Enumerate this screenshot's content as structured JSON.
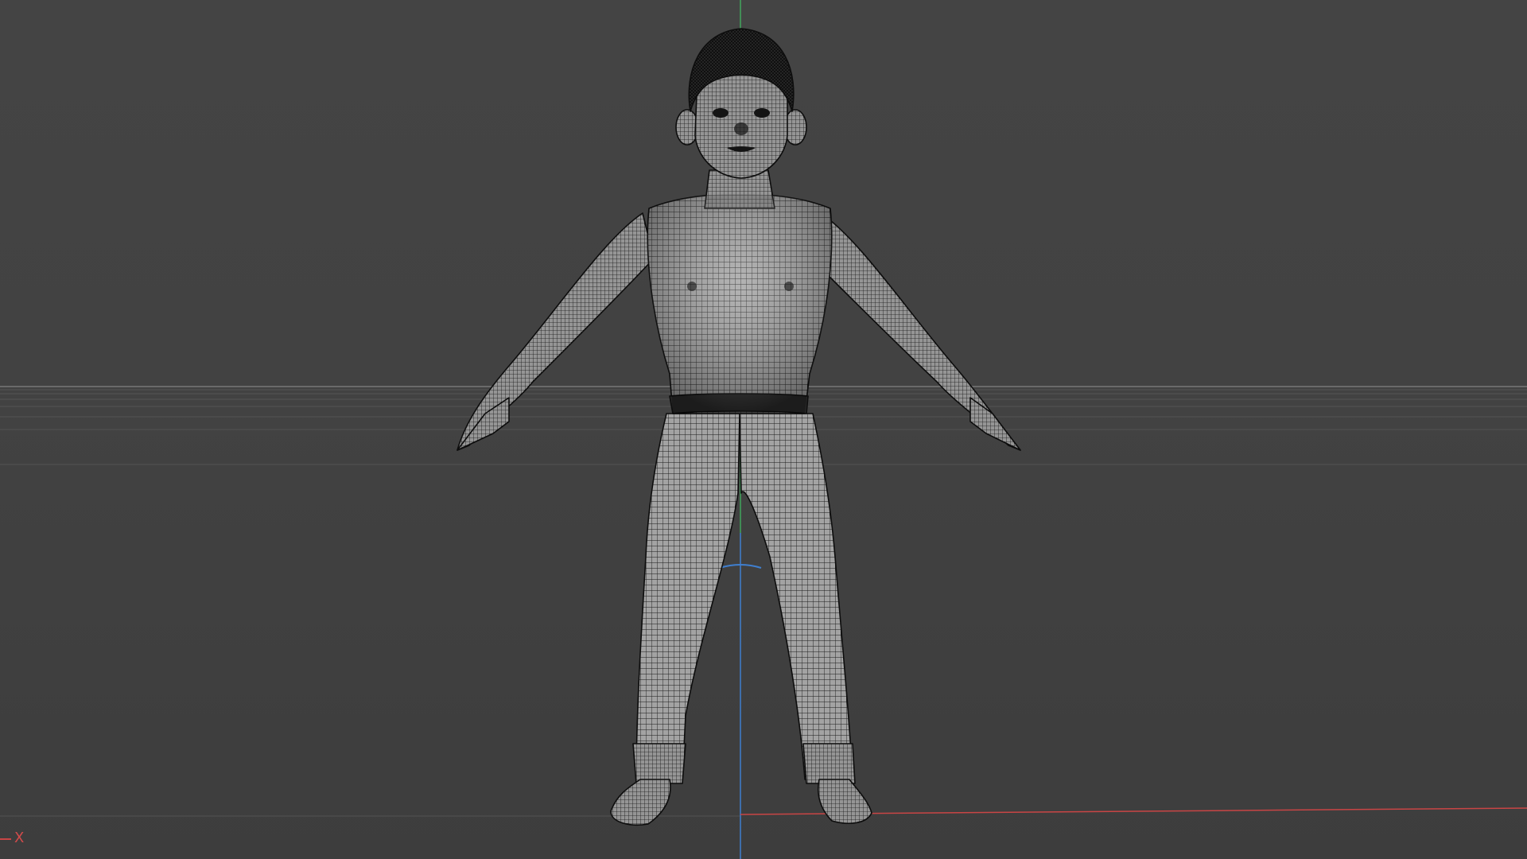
{
  "viewport": {
    "name": "3d-perspective-viewport",
    "background_color": "#424242",
    "grid_color": "#575757",
    "horizon_color": "#5e5e5e",
    "x_axis_color": "#c94545",
    "y_axis_color": "#41a55c",
    "z_axis_color": "#3f7fcf",
    "wire_color": "#111111",
    "shade_color": "#9a9a9a"
  },
  "model": {
    "display_mode": "wireframe",
    "subject": "child-character-a-pose",
    "icon": "mesh-icon"
  },
  "axis_indicator": {
    "label": "X",
    "icon": "x-axis-icon"
  }
}
